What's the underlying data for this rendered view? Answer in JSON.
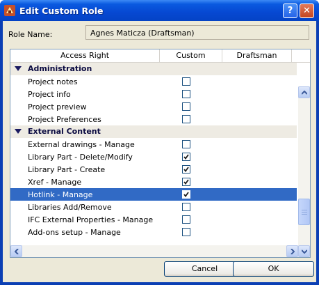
{
  "window": {
    "title": "Edit Custom Role",
    "help_glyph": "?",
    "close_glyph": "✕"
  },
  "role": {
    "label": "Role Name:",
    "value": "Agnes Maticza (Draftsman)"
  },
  "table": {
    "headers": [
      "Access Right",
      "Custom",
      "Draftsman"
    ],
    "rows": [
      {
        "type": "group",
        "label": "Administration"
      },
      {
        "type": "item",
        "label": "Project notes",
        "checked": false
      },
      {
        "type": "item",
        "label": "Project info",
        "checked": false
      },
      {
        "type": "item",
        "label": "Project preview",
        "checked": false
      },
      {
        "type": "item",
        "label": "Project Preferences",
        "checked": false
      },
      {
        "type": "group",
        "label": "External Content"
      },
      {
        "type": "item",
        "label": "External drawings - Manage",
        "checked": false
      },
      {
        "type": "item",
        "label": "Library Part - Delete/Modify",
        "checked": true
      },
      {
        "type": "item",
        "label": "Library Part - Create",
        "checked": true
      },
      {
        "type": "item",
        "label": "Xref - Manage",
        "checked": true
      },
      {
        "type": "item",
        "label": "Hotlink - Manage",
        "checked": true,
        "selected": true
      },
      {
        "type": "item",
        "label": "Libraries Add/Remove",
        "checked": false
      },
      {
        "type": "item",
        "label": "IFC External Properties - Manage",
        "checked": false
      },
      {
        "type": "item",
        "label": "Add-ons setup - Manage",
        "checked": false
      }
    ]
  },
  "scroll": {
    "position_fraction": 0.83
  },
  "buttons": {
    "cancel": "Cancel",
    "ok": "OK"
  },
  "colors": {
    "selection": "#316ac5",
    "titlebar": "#0a5ae0",
    "dialog_bg": "#ece9d8"
  }
}
